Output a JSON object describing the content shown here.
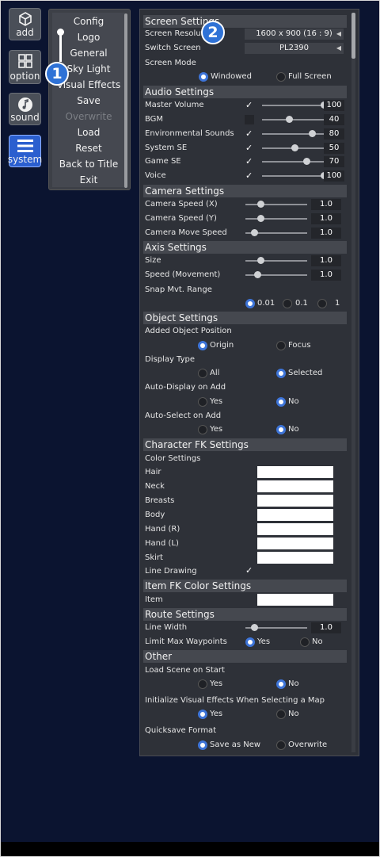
{
  "tools": [
    {
      "label": "add",
      "icon": "cube-icon"
    },
    {
      "label": "option",
      "icon": "grid-icon"
    },
    {
      "label": "sound",
      "icon": "music-note-icon"
    },
    {
      "label": "system",
      "icon": "menu-icon"
    }
  ],
  "system_menu": [
    "Config",
    "Logo",
    "General",
    "Sky Light",
    "Visual Effects",
    "Save",
    "Overwrite",
    "Load",
    "Reset",
    "Back to Title",
    "Exit"
  ],
  "badges": [
    "1",
    "2"
  ],
  "screen": {
    "header": "Screen Settings",
    "resolution_label": "Screen Resolution",
    "resolution_value": "1600 x 900 (16 : 9)",
    "switch_label": "Switch Screen",
    "switch_value": "PL2390",
    "mode_label": "Screen Mode",
    "mode_windowed": "Windowed",
    "mode_fullscreen": "Full Screen"
  },
  "audio": {
    "header": "Audio Settings",
    "rows": [
      {
        "label": "Master Volume",
        "checked": true,
        "value": "100",
        "level": 1.0
      },
      {
        "label": "BGM",
        "checked": false,
        "value": "40",
        "level": 0.4
      },
      {
        "label": "Environmental Sounds",
        "checked": true,
        "value": "80",
        "level": 0.8
      },
      {
        "label": "System SE",
        "checked": true,
        "value": "50",
        "level": 0.5
      },
      {
        "label": "Game SE",
        "checked": true,
        "value": "70",
        "level": 0.7
      },
      {
        "label": "Voice",
        "checked": true,
        "value": "100",
        "level": 1.0
      }
    ]
  },
  "camera": {
    "header": "Camera Settings",
    "rows": [
      {
        "label": "Camera Speed (X)",
        "value": "1.0",
        "level": 0.2
      },
      {
        "label": "Camera Speed (Y)",
        "value": "1.0",
        "level": 0.2
      },
      {
        "label": "Camera Move Speed",
        "value": "1.0",
        "level": 0.1
      }
    ]
  },
  "axis": {
    "header": "Axis Settings",
    "rows": [
      {
        "label": "Size",
        "value": "1.0",
        "level": 0.2
      },
      {
        "label": "Speed (Movement)",
        "value": "1.0",
        "level": 0.15
      }
    ],
    "snap_label": "Snap Mvt. Range",
    "snap_options": [
      "0.01",
      "0.1",
      "1"
    ]
  },
  "object": {
    "header": "Object Settings",
    "added_label": "Added Object Position",
    "added_options": [
      "Origin",
      "Focus"
    ],
    "display_label": "Display Type",
    "display_options": [
      "All",
      "Selected"
    ],
    "autodisplay_label": "Auto-Display on Add",
    "autoselect_label": "Auto-Select on Add",
    "yes": "Yes",
    "no": "No"
  },
  "character": {
    "header": "Character FK Settings",
    "color_label": "Color Settings",
    "parts": [
      "Hair",
      "Neck",
      "Breasts",
      "Body",
      "Hand (R)",
      "Hand (L)",
      "Skirt"
    ],
    "line_label": "Line Drawing"
  },
  "item": {
    "header": "Item FK Color Settings",
    "label": "Item"
  },
  "route": {
    "header": "Route Settings",
    "width_label": "Line Width",
    "width_value": "1.0",
    "width_level": 0.1,
    "waypoint_label": "Limit Max Waypoints"
  },
  "other": {
    "header": "Other",
    "load_label": "Load Scene on Start",
    "init_label": "Initialize Visual Effects When Selecting a Map",
    "quicksave_label": "Quicksave Format",
    "save_new": "Save as New",
    "overwrite": "Overwrite"
  },
  "colors": {
    "accent": "#2f72d6",
    "background": "#0b1430",
    "panel": "#2e3138",
    "header": "#45484f"
  }
}
